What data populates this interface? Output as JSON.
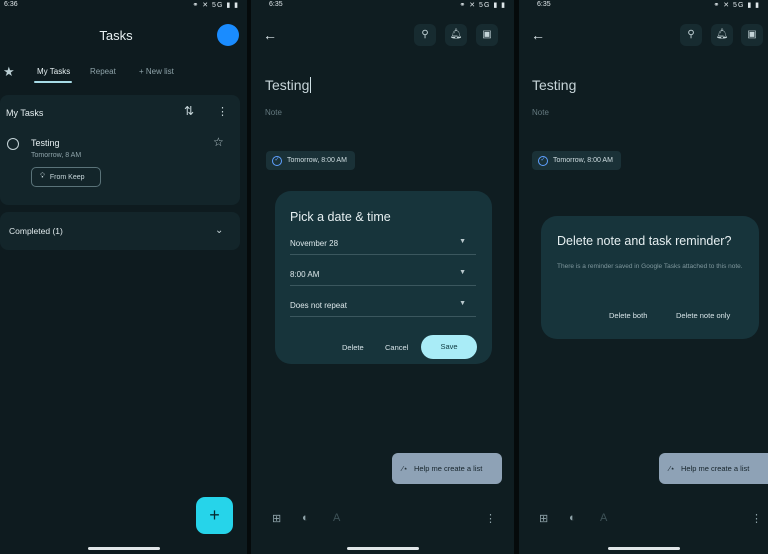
{
  "panel1": {
    "status_time": "6:36",
    "status_icons": "⚭ ✕ 5G ▮ ▮",
    "title": "Tasks",
    "tabs": [
      "My Tasks",
      "Repeat",
      "+ New list"
    ],
    "list_title": "My Tasks",
    "task": {
      "title": "Testing",
      "subtitle": "Tomorrow, 8 AM",
      "chip": "From Keep"
    },
    "completed": "Completed (1)"
  },
  "panel2": {
    "status_time": "6:35",
    "status_icons": "⚭ ✕ 5G ▮ ▮",
    "note_title": "Testing",
    "note_placeholder": "Note",
    "reminder": "Tomorrow, 8:00 AM",
    "dialog": {
      "title": "Pick a date & time",
      "date": "November 28",
      "time": "8:00 AM",
      "repeat": "Does not repeat",
      "delete": "Delete",
      "cancel": "Cancel",
      "save": "Save"
    },
    "help": "Help me create a list"
  },
  "panel3": {
    "status_time": "6:35",
    "status_icons": "⚭ ✕ 5G ▮ ▮",
    "note_title": "Testing",
    "note_placeholder": "Note",
    "reminder": "Tomorrow, 8:00 AM",
    "dialog": {
      "title": "Delete note and task reminder?",
      "body": "There is a reminder saved in Google Tasks attached to this note.",
      "delete_both": "Delete both",
      "delete_note_only": "Delete note only"
    },
    "help": "Help me create a list"
  }
}
